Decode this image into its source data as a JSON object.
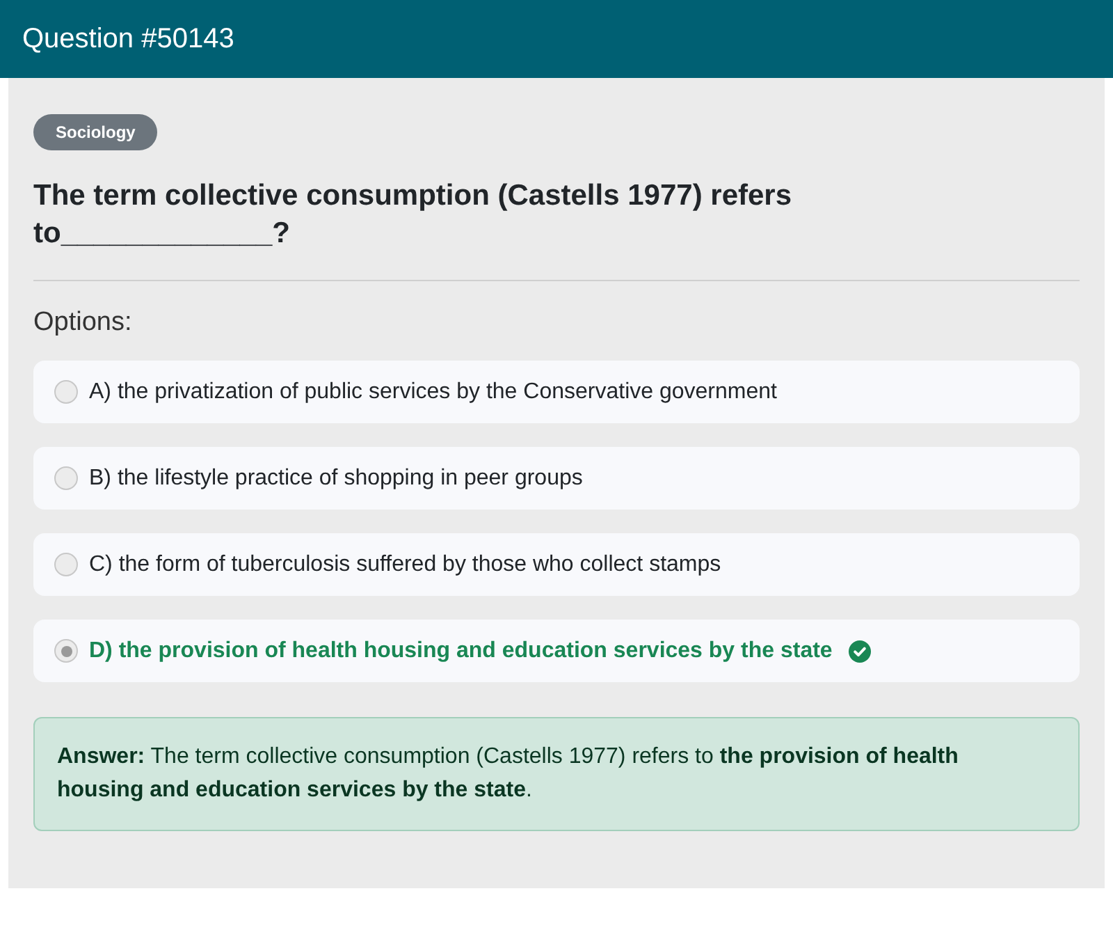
{
  "header": {
    "title": "Question #50143"
  },
  "question": {
    "tag": "Sociology",
    "text": "The term collective consumption (Castells 1977) refers to_____________?"
  },
  "options_heading": "Options:",
  "options": [
    {
      "label": "A) the privatization of public services by the Conservative government",
      "selected": false,
      "correct": false
    },
    {
      "label": "B) the lifestyle practice of shopping in peer groups",
      "selected": false,
      "correct": false
    },
    {
      "label": "C) the form of tuberculosis suffered by those who collect stamps",
      "selected": false,
      "correct": false
    },
    {
      "label": "D) the provision of health housing and education services by the state",
      "selected": true,
      "correct": true
    }
  ],
  "answer": {
    "text": "**Answer:** The term collective consumption (Castells 1977) refers to **the provision of health housing and education services by the state**."
  }
}
